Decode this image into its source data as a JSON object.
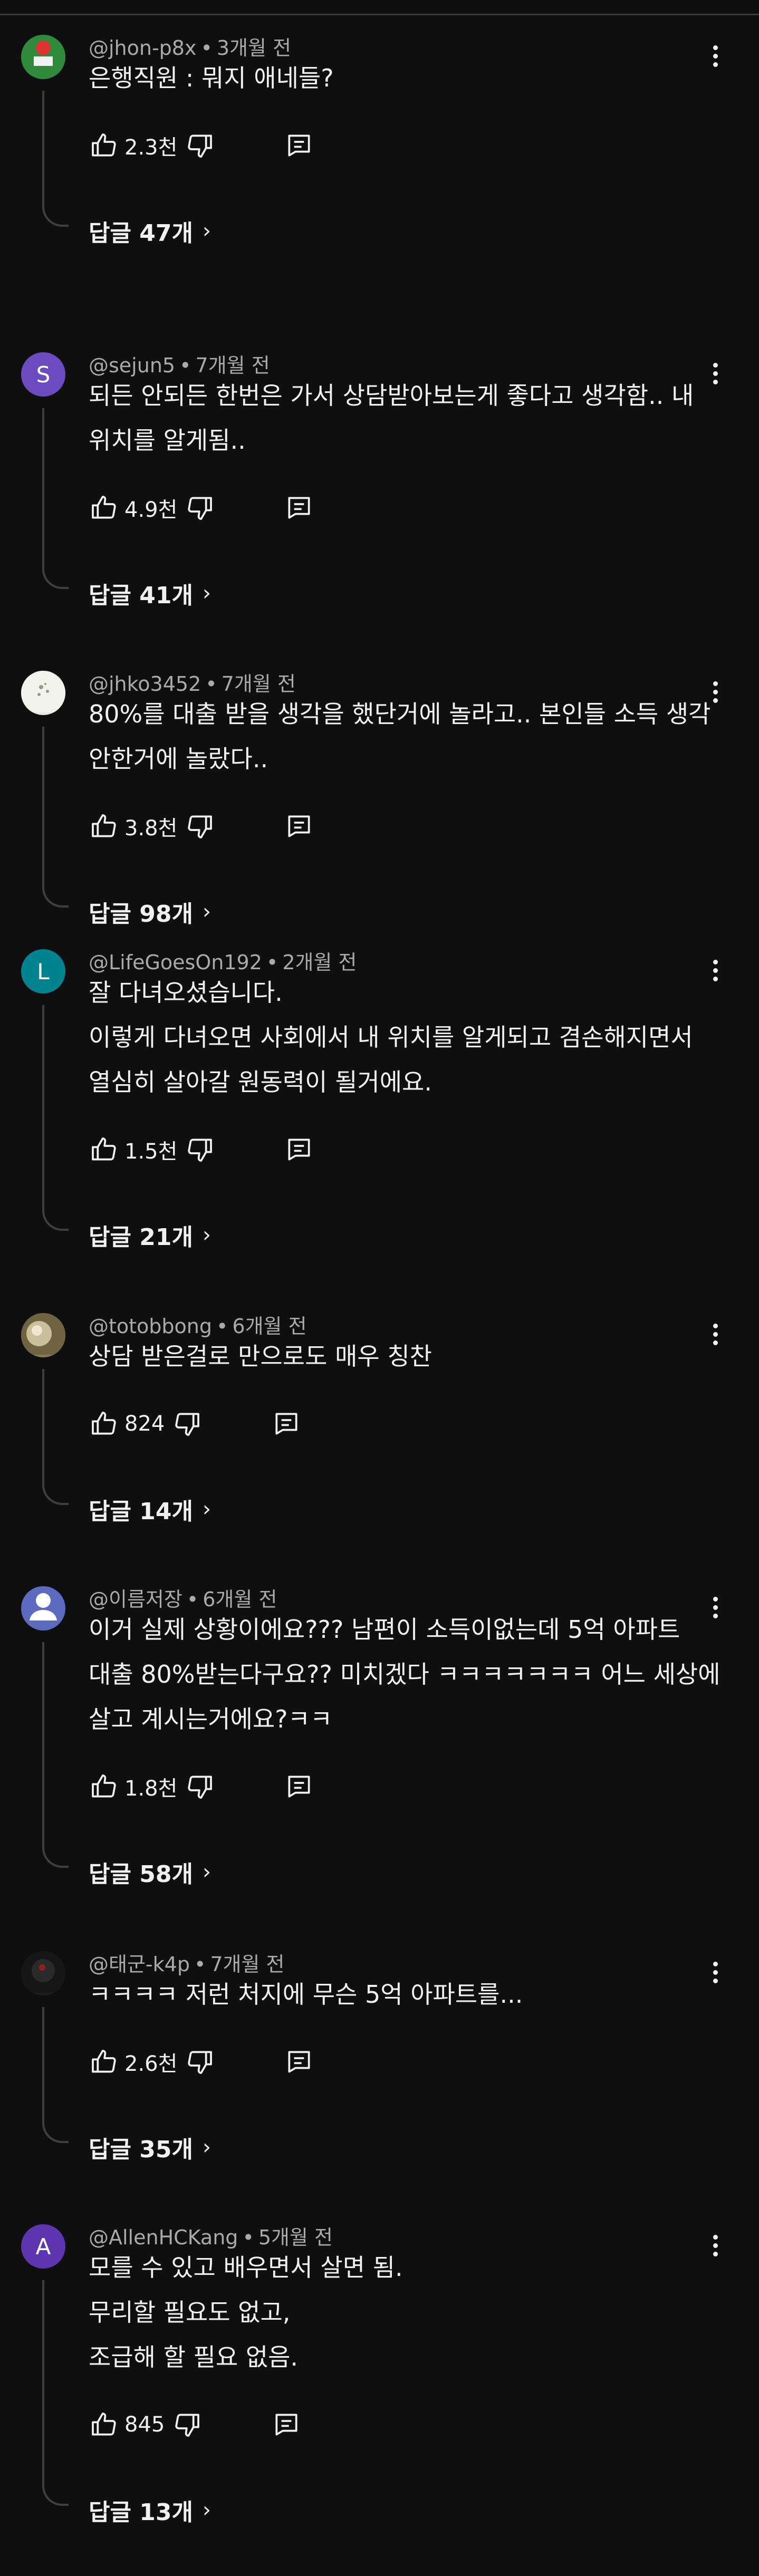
{
  "comments": [
    {
      "handle": "@jhon-p8x",
      "time": "3개월 전",
      "avatar": {
        "type": "image",
        "color": "#2f8a3c",
        "letter": ""
      },
      "lines": [
        "은행직원 : 뭐지 애네들?"
      ],
      "likes": "2.3천",
      "replies": "답글 47개"
    },
    {
      "handle": "@sejun5",
      "time": "7개월 전",
      "avatar": {
        "type": "letter",
        "color": "#6b4bbf",
        "letter": "S"
      },
      "lines": [
        "되든 안되든 한번은 가서 상담받아보는게 좋다고 생각함.. 내",
        "위치를 알게됨.."
      ],
      "likes": "4.9천",
      "replies": "답글 41개"
    },
    {
      "handle": "@jhko3452",
      "time": "7개월 전",
      "avatar": {
        "type": "image",
        "color": "#e8e8e2",
        "letter": ""
      },
      "lines": [
        "80%를 대출 받을 생각을 했단거에 놀라고.. 본인들 소득 생각",
        "안한거에 놀랐다.."
      ],
      "likes": "3.8천",
      "replies": "답글 98개"
    },
    {
      "handle": "@LifeGoesOn192",
      "time": "2개월 전",
      "avatar": {
        "type": "letter",
        "color": "#00838f",
        "letter": "L"
      },
      "lines": [
        "잘 다녀오셨습니다.",
        "이렇게 다녀오면 사회에서 내 위치를 알게되고 겸손해지면서",
        "열심히 살아갈 원동력이 될거에요."
      ],
      "likes": "1.5천",
      "replies": "답글 21개"
    },
    {
      "handle": "@totobbong",
      "time": "6개월 전",
      "avatar": {
        "type": "image",
        "color": "#8a7a52",
        "letter": ""
      },
      "lines": [
        "상담 받은걸로  만으로도  매우 칭찬"
      ],
      "likes": "824",
      "replies": "답글 14개"
    },
    {
      "handle": "@이름저장",
      "time": "6개월 전",
      "avatar": {
        "type": "person",
        "color": "#5c6bc0",
        "letter": ""
      },
      "lines": [
        "이거 실제 상황이에요??? 남편이 소득이없는데 5억 아파트",
        "대출 80%받는다구요?? 미치겠다 ㅋㅋㅋㅋㅋㅋㅋ 어느 세상에",
        "살고 계시는거에요?ㅋㅋ"
      ],
      "likes": "1.8천",
      "replies": "답글 58개"
    },
    {
      "handle": "@태군-k4p",
      "time": "7개월 전",
      "avatar": {
        "type": "image",
        "color": "#1e1e1e",
        "letter": ""
      },
      "lines": [
        "ㅋㅋㅋㅋ 저런 처지에 무슨 5억 아파트를..."
      ],
      "likes": "2.6천",
      "replies": "답글 35개"
    },
    {
      "handle": "@AllenHCKang",
      "time": "5개월 전",
      "avatar": {
        "type": "letter",
        "color": "#5e35b1",
        "letter": "A"
      },
      "lines": [
        "모를 수 있고 배우면서 살면 됨.",
        "무리할 필요도 없고,",
        "조급해 할 필요 없음."
      ],
      "likes": "845",
      "replies": "답글 13개"
    }
  ]
}
